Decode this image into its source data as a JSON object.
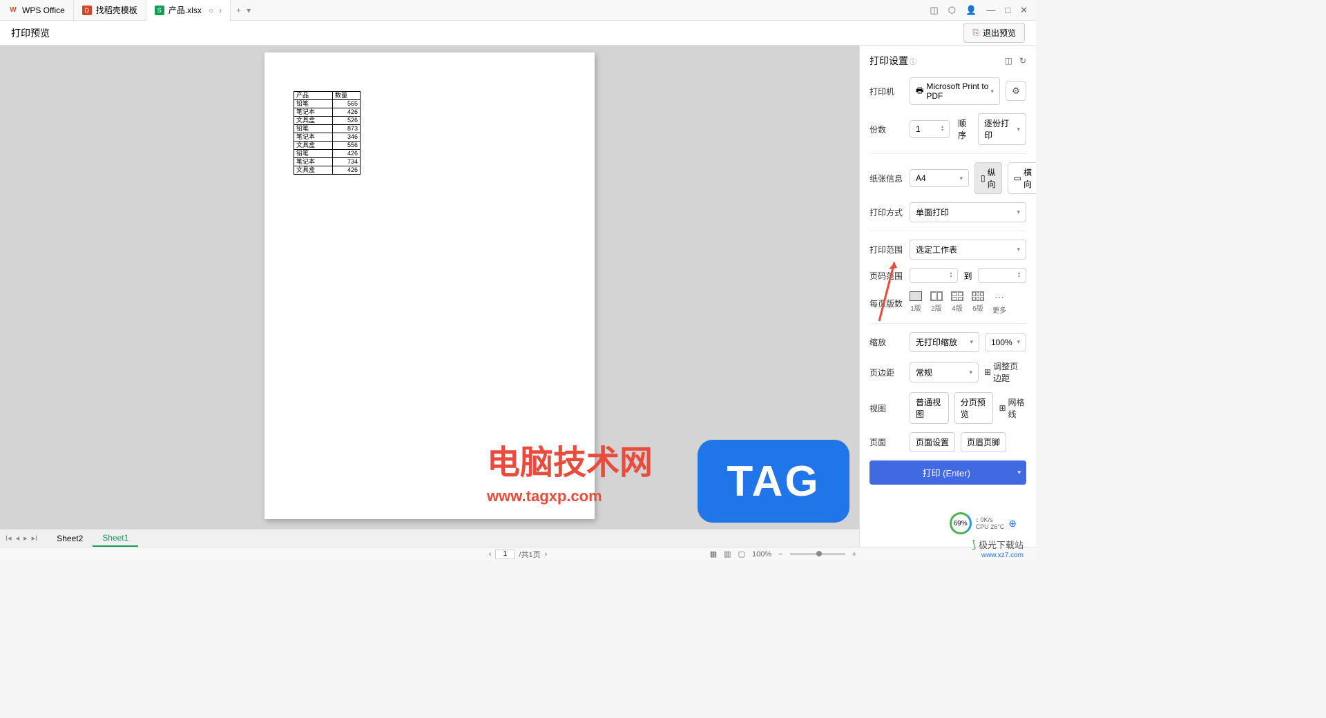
{
  "tabs": {
    "wps": "WPS Office",
    "template": "找稻壳模板",
    "file": "产品.xlsx"
  },
  "header": {
    "title": "打印预览",
    "exit_label": "退出预览"
  },
  "preview_table": {
    "headers": [
      "产品",
      "数量"
    ],
    "rows": [
      [
        "铅笔",
        "565"
      ],
      [
        "笔记本",
        "426"
      ],
      [
        "文具盒",
        "526"
      ],
      [
        "铅笔",
        "873"
      ],
      [
        "笔记本",
        "346"
      ],
      [
        "文具盒",
        "556"
      ],
      [
        "铅笔",
        "426"
      ],
      [
        "笔记本",
        "734"
      ],
      [
        "文具盒",
        "426"
      ]
    ]
  },
  "panel": {
    "title": "打印设置",
    "printer_label": "打印机",
    "printer_value": "Microsoft Print to PDF",
    "copies_label": "份数",
    "copies_value": "1",
    "order_label": "顺序",
    "order_value": "逐份打印",
    "paper_label": "纸张信息",
    "paper_value": "A4",
    "orient_portrait": "纵向",
    "orient_landscape": "横向",
    "print_mode_label": "打印方式",
    "print_mode_value": "单面打印",
    "print_range_label": "打印范围",
    "print_range_value": "选定工作表",
    "page_range_label": "页码范围",
    "page_range_to": "到",
    "pages_per_label": "每页版数",
    "layout_1": "1版",
    "layout_2": "2版",
    "layout_4": "4版",
    "layout_6": "6版",
    "layout_more": "更多",
    "scale_label": "缩放",
    "scale_value": "无打印缩放",
    "scale_percent": "100%",
    "margin_label": "页边距",
    "margin_value": "常规",
    "margin_adjust": "调整页边距",
    "view_label": "视图",
    "view_normal": "普通视图",
    "view_page": "分页预览",
    "view_grid": "网格线",
    "page_label": "页面",
    "page_setup": "页面设置",
    "page_header": "页眉页脚",
    "print_button": "打印 (Enter)"
  },
  "sheets": {
    "sheet2": "Sheet2",
    "sheet1": "Sheet1"
  },
  "status": {
    "page_current": "1",
    "page_total": "/共1页",
    "zoom": "100%"
  },
  "overlay": {
    "site_name": "电脑技术网",
    "site_url": "www.tagxp.com",
    "tag": "TAG",
    "perf_percent": "69%",
    "perf_net": "0K/s",
    "perf_cpu": "CPU 26°C",
    "dl_name": "极光下载站",
    "dl_url": "www.xz7.com"
  }
}
